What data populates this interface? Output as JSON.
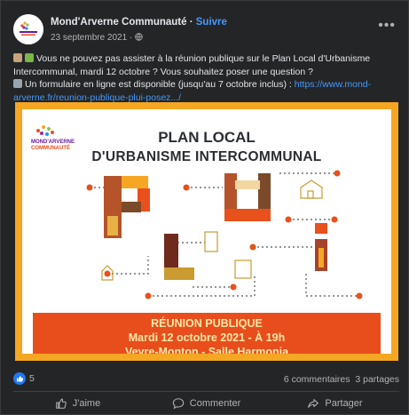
{
  "post": {
    "page_name": "Mond'Arverne Communauté",
    "separator": " · ",
    "follow_label": "Suivre",
    "date": "23 septembre 2021",
    "meta_separator": " · ",
    "more_icon": "more-horizontal-icon",
    "text_line1": "Vous ne pouvez pas assister à la réunion publique sur le Plan Local d'Urbanisme",
    "text_line2": "Intercommunal, mardi 12 octobre ? Vous souhaitez poser une question ?",
    "text_line3": "Un formulaire en ligne est disponible (jusqu'au 7 octobre inclus) : ",
    "link_part1": "https://www.mond-",
    "link_part2": "arverne.fr/reunion-publique-plui-posez.../",
    "text_icons": [
      "people-icon",
      "hand-icon",
      "laptop-icon"
    ]
  },
  "poster": {
    "logo_line1": "MOND'ARVERNE",
    "logo_line2": "COMMUNAUTÉ",
    "title_line1": "PLAN LOCAL",
    "title_line2": "D'URBANISME INTERCOMMUNAL",
    "banner_line1": "RÉUNION PUBLIQUE",
    "banner_line2": "Mardi 12 octobre 2021 - À 19h",
    "banner_line3": "Veyre-Monton - Salle Harmonia",
    "colors": {
      "frame": "#f5a623",
      "banner": "#e84e1b",
      "banner_text": "#ffe9a8",
      "accent": "#e8501c",
      "dark": "#2a2d33"
    }
  },
  "stats": {
    "like_count": "5",
    "comments": "6 commentaires",
    "shares": "3 partages"
  },
  "actions": {
    "like_label": "J'aime",
    "comment_label": "Commenter",
    "share_label": "Partager"
  },
  "theme": {
    "background": "#242526",
    "text": "#e4e6eb",
    "muted": "#b0b3b8",
    "link": "#4599ff",
    "like_blue": "#2078f4"
  }
}
